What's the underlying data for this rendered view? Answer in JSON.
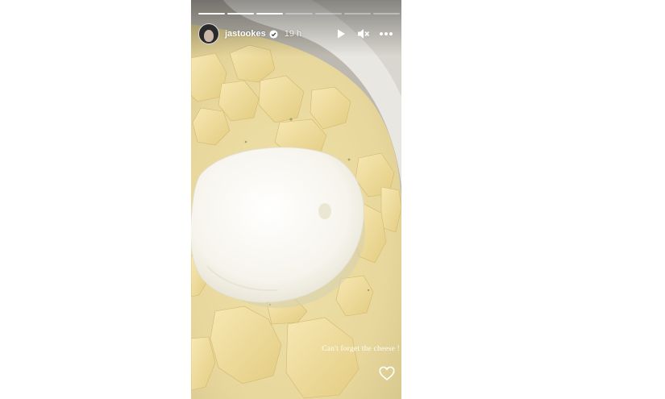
{
  "story": {
    "segments_total": 7,
    "segments_viewed": 3,
    "author": {
      "username": "jastookes",
      "verified": true,
      "avatar_icon": "profile-photo"
    },
    "time_ago": "19 h",
    "controls": {
      "play_icon": "play-icon",
      "mute_icon": "muted-speaker-icon",
      "more_icon": "more-options-icon"
    },
    "caption": "Can't forget the cheese !",
    "like_icon": "heart-outline-icon"
  },
  "colors": {
    "page_background": "#ffffff",
    "broth": "#ead9a0",
    "potato": "#f1dfa0",
    "cheese": "#f7f5ee",
    "bowl": "#ecebe6",
    "ui_white": "#ffffff"
  }
}
